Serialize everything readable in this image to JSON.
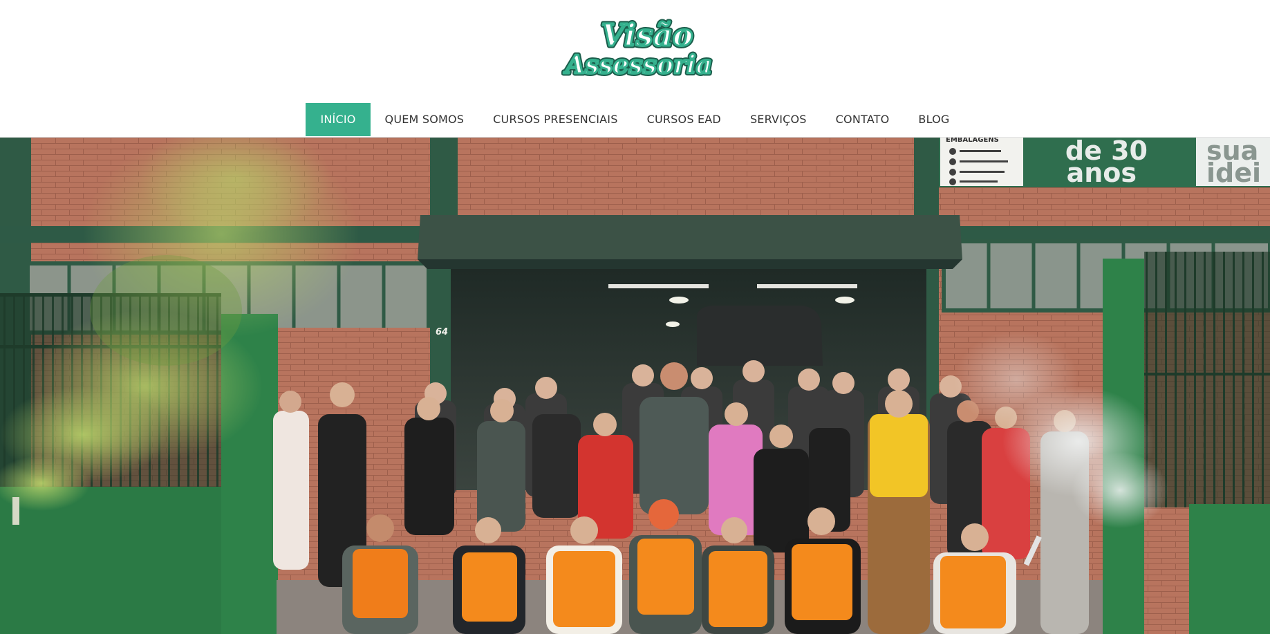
{
  "site": {
    "logo_line1": "Visão",
    "logo_line2": "Assessoria",
    "brand_color": "#35b18e",
    "logo_dark": "#1c5e4c"
  },
  "nav": {
    "items": [
      {
        "label": "INÍCIO",
        "active": true
      },
      {
        "label": "QUEM SOMOS",
        "active": false
      },
      {
        "label": "CURSOS PRESENCIAIS",
        "active": false
      },
      {
        "label": "CURSOS EAD",
        "active": false
      },
      {
        "label": "SERVIÇOS",
        "active": false
      },
      {
        "label": "CONTATO",
        "active": false
      },
      {
        "label": "BLOG",
        "active": false
      }
    ]
  },
  "hero": {
    "building_number": "64",
    "sign_left": "EMBALAGENS",
    "sign_big_1": "de 30",
    "sign_big_2": "anos",
    "sign_right_1": "sua",
    "sign_right_2": "idei"
  }
}
